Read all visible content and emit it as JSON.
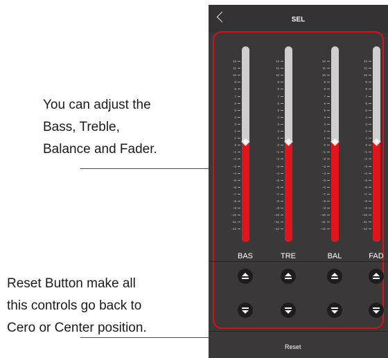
{
  "annotations": {
    "adjust": [
      "You can adjust the",
      "Bass, Treble,",
      "Balance and Fader."
    ],
    "reset": [
      "Reset Button make all",
      "this controls go back to",
      "Cero or Center position."
    ]
  },
  "header": {
    "title": "SEL",
    "back_icon": "chevron-left-icon"
  },
  "scale_labels": [
    "12",
    "11",
    "10",
    "9",
    "8",
    "7",
    "6",
    "5",
    "4",
    "3",
    "2",
    "1",
    "0",
    "−1",
    "−2",
    "−3",
    "−4",
    "−5",
    "−6",
    "−7",
    "−8",
    "−9",
    "−10",
    "−11",
    "−12"
  ],
  "controls": [
    {
      "label": "BAS",
      "value": 0,
      "min": -12,
      "max": 12
    },
    {
      "label": "TRE",
      "value": 0,
      "min": -12,
      "max": 12
    },
    {
      "label": "BAL",
      "value": 0,
      "min": -12,
      "max": 12
    },
    {
      "label": "FAD",
      "value": 0,
      "min": -12,
      "max": 12
    }
  ],
  "buttons": {
    "up_icon": "triangle-up-bar-icon",
    "down_icon": "triangle-down-bar-icon"
  },
  "reset_label": "Reset",
  "colors": {
    "accent": "#e0141b",
    "background": "#3a3838",
    "track": "#cfcfcf"
  }
}
